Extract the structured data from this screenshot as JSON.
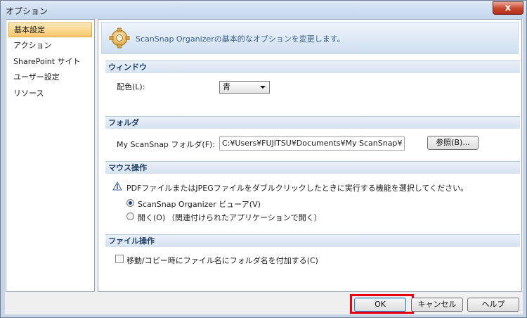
{
  "window": {
    "title": "オプション",
    "close_symbol": "x"
  },
  "nav": {
    "items": [
      {
        "label": "基本設定",
        "selected": true
      },
      {
        "label": "アクション",
        "selected": false
      },
      {
        "label": "SharePoint サイト",
        "selected": false
      },
      {
        "label": "ユーザー設定",
        "selected": false
      },
      {
        "label": "リソース",
        "selected": false
      }
    ]
  },
  "banner": {
    "text": "ScanSnap Organizerの基本的なオプションを変更します。",
    "icon": "gear-icon"
  },
  "window_section": {
    "header": "ウィンドウ",
    "color_label": "配色(L):",
    "color_value": "青"
  },
  "folder_section": {
    "header": "フォルダ",
    "folder_label": "My ScanSnap フォルダ(F):",
    "folder_value": "C:¥Users¥FUJITSU¥Documents¥My ScanSnap¥",
    "browse_label": "参照(B)..."
  },
  "mouse_section": {
    "header": "マウス操作",
    "info_text": "PDFファイルまたはJPEGファイルをダブルクリックしたときに実行する機能を選択してください。",
    "option_viewer": "ScanSnap Organizer ビューア(V)",
    "option_open": "開く(O)",
    "option_open_note": "（関連付けられたアプリケーションで開く）",
    "selected_option": "viewer"
  },
  "file_section": {
    "header": "ファイル操作",
    "checkbox_label": "移動/コピー時にファイル名にフォルダ名を付加する(C)",
    "checked": false
  },
  "footer": {
    "ok_label": "OK",
    "cancel_label": "キャンセル",
    "help_label": "ヘルプ",
    "highlight_color": "#e60012"
  }
}
